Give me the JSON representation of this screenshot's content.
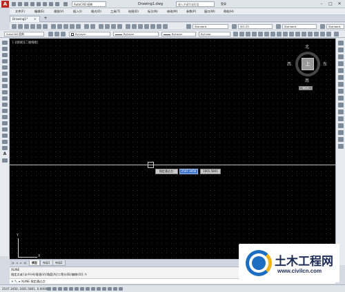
{
  "title_bar": {
    "workspace": "AutoCAD 经典",
    "doc_title": "Drawing1.dwg",
    "search_placeholder": "键入关键字或短语",
    "login": "登录",
    "minimize": "–",
    "maximize": "□",
    "close": "✕"
  },
  "menus": [
    "文件(F)",
    "编辑(E)",
    "视图(V)",
    "插入(I)",
    "格式(O)",
    "工具(T)",
    "绘图(D)",
    "标注(N)",
    "修改(M)",
    "参数(P)",
    "窗口(W)",
    "帮助(H)"
  ],
  "doc_tab": {
    "label": "Drawing1*",
    "close": "×",
    "add": "+"
  },
  "toolbar1": {
    "text_style": "Standard",
    "dim_style": "ISO-25",
    "table_style": "Standard",
    "mleader_style": "Standard"
  },
  "toolbar2": {
    "workspace": "AutoCAD 经典",
    "layer_color": "ByLayer",
    "linetype": "ByLayer",
    "lineweight": "ByLayer",
    "plot_style": "ByColor"
  },
  "viewport": {
    "label": "[-][俯视][二维线框]",
    "dyn_prompt": "指定通过点:",
    "dyn_x": "2547.3450",
    "dyn_y": "1601.5801"
  },
  "viewcube": {
    "north": "北",
    "south": "南",
    "west": "西",
    "east": "东",
    "face": "上",
    "wcs": "WCS"
  },
  "ucs": {
    "x": "X",
    "y": "Y"
  },
  "layout_tabs": [
    "模型",
    "布局1",
    "布局2"
  ],
  "command": {
    "history1": "XLINE",
    "history2": "指定点或 [水平(H)/垂直(V)/角度(A)/二等分(B)/偏移(O)]: h",
    "prompt": "✕  🔧  ▸ XLINE 指定通过点:"
  },
  "status": {
    "coords": "2547.3450, 1601.5801, 0.0000"
  },
  "watermark": {
    "title": "土木工程网",
    "url": "www.civilcn.com"
  }
}
